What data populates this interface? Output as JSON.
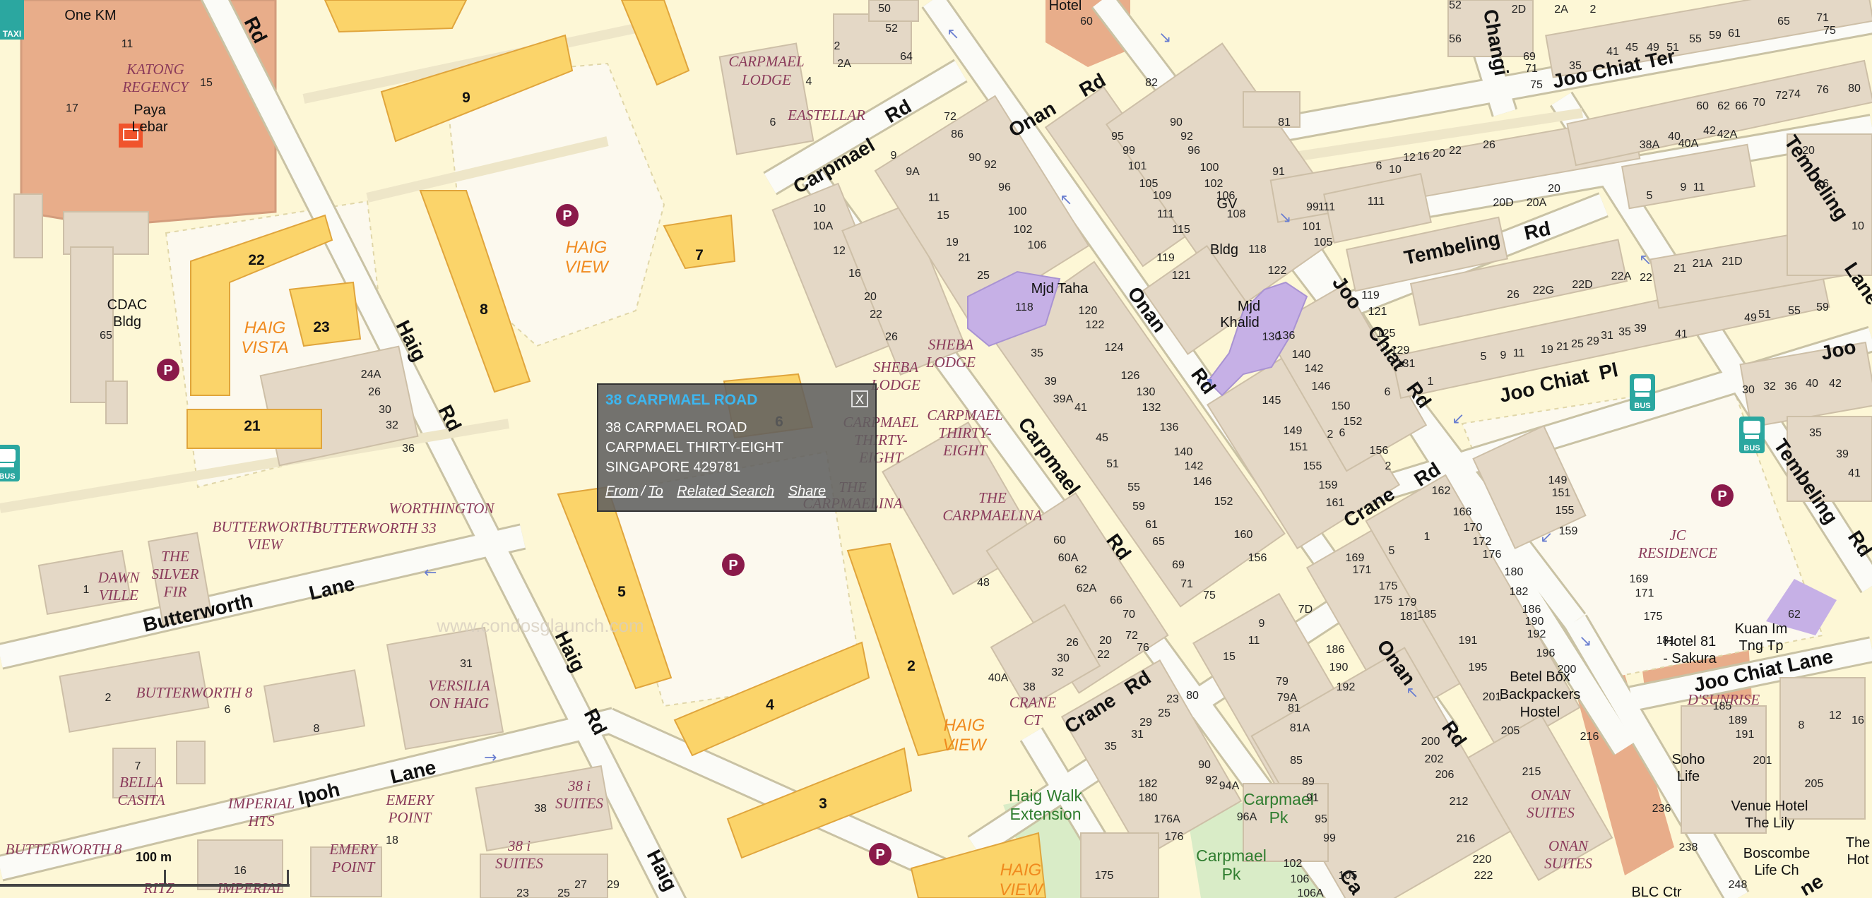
{
  "popup": {
    "title": "38 CARPMAEL ROAD",
    "close": "X",
    "lines": [
      "38 CARPMAEL ROAD",
      "CARPMAEL THIRTY-EIGHT",
      "SINGAPORE 429781"
    ],
    "links": {
      "from": "From",
      "sep": "/",
      "to": "To",
      "related": "Related Search",
      "share": "Share"
    }
  },
  "scale_label": "100 m",
  "watermark": "www.condosglaunch.com",
  "colors": {
    "background": "#fdf7d6",
    "road": "#f8f8f4",
    "road_edge": "#c9c2a4",
    "building": "#e4d8c6",
    "hdb_block": "#fbd46a",
    "mosque": "#c6b0e6",
    "commercial": "#e5aa8e",
    "parking": "#8a1a4a",
    "estate_label": "#f08a1e",
    "condo_label": "#8a3a5a",
    "park_label": "#2f7d2f"
  },
  "map": {
    "roads": [
      "Haig Rd",
      "Carpmael Rd",
      "Onan Rd",
      "Joo Chiat Rd",
      "Joo Chiat Pl",
      "Joo Chiat Ter",
      "Joo Chiat Lane",
      "Tembeling Rd",
      "Crane Rd",
      "Butterworth Lane",
      "Ipoh Lane",
      "Changi",
      "Joo"
    ],
    "estate_labels": [
      "HAIG VIEW",
      "HAIG VISTA"
    ],
    "condo_labels": [
      "CARPMAEL LODGE",
      "EASTELLAR",
      "SHEBA LODGE",
      "CARPMAEL THIRTY-EIGHT",
      "THE CARPMAELINA",
      "KATONG REGENCY",
      "WORTHINGTON",
      "BUTTERWORTH VIEW",
      "BUTTERWORTH 33",
      "THE SILVER FIR",
      "DAWN VILLE",
      "BUTTERWORTH 8",
      "VERSILIA ON HAIG",
      "BELLA CASITA",
      "IMPERIAL HTS",
      "EMERY POINT",
      "38 i SUITES",
      "CRANE CT",
      "ONAN SUITES",
      "D'SUNRISE",
      "JC RESIDENCE",
      "RITZ REGENCY",
      "IMPERIAL"
    ],
    "places": [
      "One KM",
      "Paya Lebar",
      "CDAC Bldg",
      "Mjd Taha",
      "Mjd Khalid",
      "GV Bldg",
      "Betel Box Backpackers Hostel",
      "Soho Life",
      "Venue Hotel The Lily",
      "Boscombe Life Ch",
      "Hotel 81 - Sakura",
      "Kuan Im Tng Tp",
      "Hotel",
      "BLC Ctr",
      "The Hot"
    ],
    "parks": [
      "Haig Walk Extension",
      "Carpmael Pk",
      "Carpmael Pk"
    ],
    "icons": [
      "taxi-icon",
      "post-office-icon",
      "parking-icon",
      "bus-stop-icon",
      "one-way-arrow-icon"
    ],
    "hdb_blocks": [
      "9",
      "7",
      "8",
      "22",
      "23",
      "21",
      "6",
      "5",
      "4",
      "3",
      "2"
    ],
    "house_numbers": [
      "11",
      "15",
      "17",
      "65",
      "24A",
      "26",
      "30",
      "32",
      "36",
      "1",
      "2",
      "6",
      "8",
      "7",
      "31",
      "38",
      "18",
      "16",
      "23",
      "25",
      "27",
      "29",
      "50",
      "52",
      "64",
      "2",
      "2A",
      "4",
      "6",
      "10",
      "10A",
      "12",
      "16",
      "20",
      "22",
      "26",
      "9",
      "9A",
      "11",
      "15",
      "19",
      "21",
      "25",
      "72",
      "86",
      "90",
      "92",
      "96",
      "100",
      "102",
      "106",
      "118",
      "35",
      "39",
      "39A",
      "41",
      "45",
      "51",
      "55",
      "59",
      "61",
      "65",
      "69",
      "71",
      "75",
      "60",
      "60A",
      "62",
      "62A",
      "66",
      "70",
      "72",
      "76",
      "26",
      "22",
      "20",
      "30",
      "32",
      "38",
      "40A",
      "48",
      "120",
      "122",
      "124",
      "126",
      "130",
      "132",
      "136",
      "140",
      "142",
      "146",
      "152",
      "160",
      "156",
      "95",
      "99",
      "101",
      "105",
      "109",
      "111",
      "115",
      "119",
      "121",
      "82",
      "90",
      "92",
      "96",
      "100",
      "102",
      "106",
      "108",
      "118",
      "122",
      "130",
      "136",
      "140",
      "142",
      "146",
      "150",
      "152",
      "156",
      "2",
      "6",
      "145",
      "149",
      "151",
      "155",
      "159",
      "161",
      "81",
      "91",
      "99",
      "101",
      "105",
      "111",
      "6",
      "10",
      "12",
      "16",
      "20",
      "22",
      "26",
      "20D",
      "20A",
      "20",
      "119",
      "121",
      "125",
      "129",
      "131",
      "1",
      "5",
      "9",
      "11",
      "19",
      "21",
      "25",
      "29",
      "31",
      "35",
      "39",
      "41",
      "26",
      "22G",
      "22D",
      "22A",
      "22",
      "21",
      "21A",
      "21D",
      "49",
      "51",
      "55",
      "59",
      "30",
      "32",
      "36",
      "40",
      "42",
      "35",
      "39",
      "41",
      "20",
      "16",
      "10",
      "5",
      "9",
      "11",
      "38A",
      "40",
      "40A",
      "42",
      "42A",
      "60",
      "62",
      "66",
      "70",
      "72",
      "74",
      "76",
      "80",
      "82",
      "69",
      "71",
      "75",
      "35",
      "41",
      "45",
      "49",
      "51",
      "55",
      "59",
      "61",
      "65",
      "71",
      "75",
      "52",
      "56",
      "2D",
      "2A",
      "2",
      "60",
      "169",
      "171",
      "175",
      "179",
      "181",
      "185",
      "5",
      "1",
      "162",
      "166",
      "170",
      "172",
      "176",
      "180",
      "182",
      "186",
      "190",
      "192",
      "196",
      "200",
      "191",
      "195",
      "201",
      "205",
      "215",
      "216",
      "9",
      "7D",
      "11",
      "15",
      "79",
      "79A",
      "81",
      "81A",
      "85",
      "89",
      "91",
      "95",
      "99",
      "105",
      "186",
      "190",
      "192",
      "200",
      "202",
      "206",
      "212",
      "216",
      "220",
      "222",
      "35",
      "31",
      "29",
      "25",
      "23",
      "80",
      "182",
      "180",
      "176A",
      "176",
      "90",
      "92",
      "94A",
      "96A",
      "102",
      "106",
      "106A",
      "175",
      "149",
      "151",
      "155",
      "159",
      "169",
      "171",
      "175",
      "181",
      "62",
      "185",
      "189",
      "191",
      "201",
      "205",
      "8",
      "12",
      "16",
      "236",
      "238",
      "248"
    ]
  }
}
